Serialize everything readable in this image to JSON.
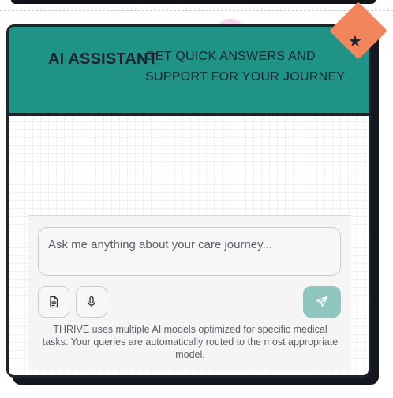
{
  "header": {
    "title": "AI ASSISTANT",
    "subtitle": "GET QUICK ANSWERS AND SUPPORT FOR YOUR JOURNEY"
  },
  "badge": {
    "icon": "star-icon",
    "glyph": "★",
    "color": "#f2855b"
  },
  "composer": {
    "placeholder": "Ask me anything about your care journey...",
    "value": "",
    "attach_icon": "document-icon",
    "mic_icon": "microphone-icon",
    "send_icon": "send-icon"
  },
  "footnote": "THRIVE uses multiple AI models optimized for specific medical tasks. Your queries are automatically routed to the most appropriate model.",
  "colors": {
    "header": "#1f9486",
    "accent": "#f2855b",
    "send_button": "#8fc7c0",
    "border": "#1f232b"
  }
}
